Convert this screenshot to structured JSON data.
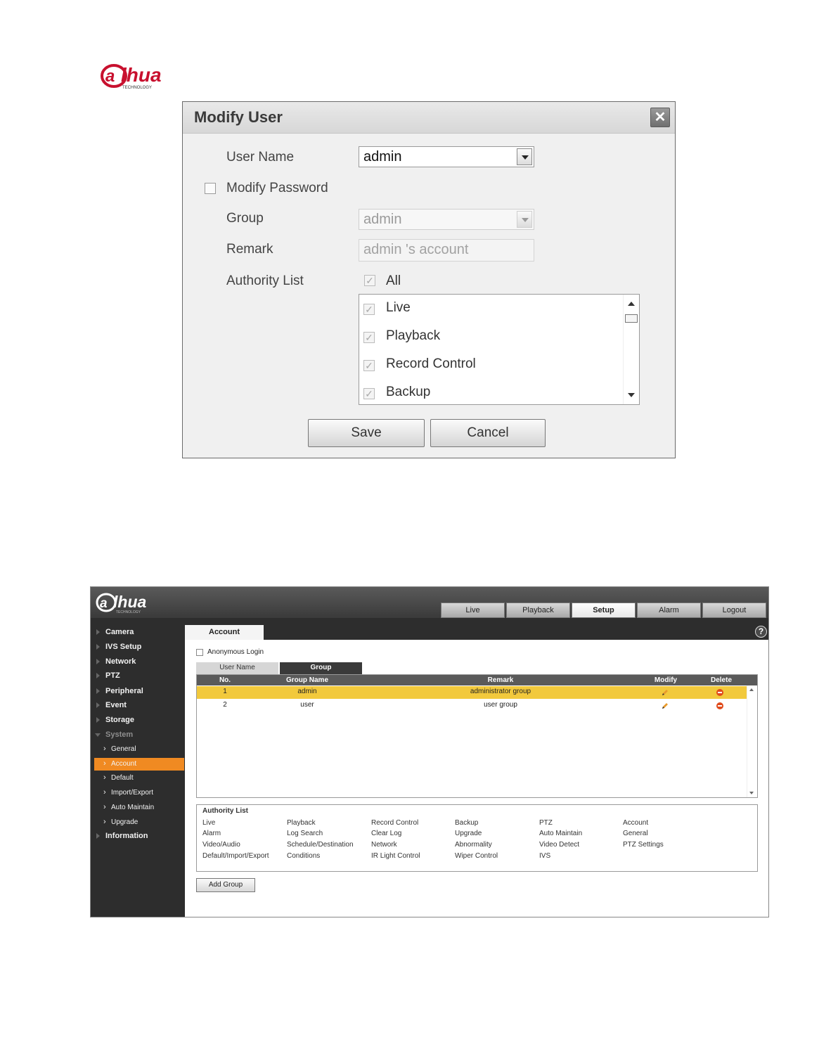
{
  "brand": {
    "name": "alhua",
    "tagline": "TECHNOLOGY",
    "color": "#c8102e"
  },
  "dialog": {
    "title": "Modify User",
    "close_icon": "close-icon",
    "user_name_label": "User Name",
    "user_name_value": "admin",
    "modify_password_label": "Modify Password",
    "modify_password_checked": false,
    "group_label": "Group",
    "group_value": "admin",
    "remark_label": "Remark",
    "remark_value": "admin 's account",
    "authority_label": "Authority List",
    "all_label": "All",
    "authority_items": [
      {
        "label": "Live",
        "checked": true
      },
      {
        "label": "Playback",
        "checked": true
      },
      {
        "label": "Record Control",
        "checked": true
      },
      {
        "label": "Backup",
        "checked": true
      }
    ],
    "save_label": "Save",
    "cancel_label": "Cancel"
  },
  "app": {
    "tabs": [
      "Live",
      "Playback",
      "Setup",
      "Alarm",
      "Logout"
    ],
    "active_tab": "Setup",
    "sidebar": {
      "items": [
        "Camera",
        "IVS Setup",
        "Network",
        "PTZ",
        "Peripheral",
        "Event",
        "Storage"
      ],
      "system": "System",
      "system_sub": [
        "General",
        "Account",
        "Default",
        "Import/Export",
        "Auto Maintain",
        "Upgrade"
      ],
      "active_sub": "Account",
      "information": "Information"
    },
    "page_tab": "Account",
    "help_icon": "help-icon",
    "anonymous_login_label": "Anonymous Login",
    "sub_tabs": [
      "User Name",
      "Group"
    ],
    "active_sub_tab": "Group",
    "table": {
      "columns": [
        "No.",
        "Group Name",
        "Remark",
        "Modify",
        "Delete"
      ],
      "rows": [
        {
          "no": "1",
          "group": "admin",
          "remark": "administrator group",
          "selected": true
        },
        {
          "no": "2",
          "group": "user",
          "remark": "user group",
          "selected": false
        }
      ]
    },
    "authority_list": {
      "title": "Authority List",
      "columns": [
        [
          "Live",
          "Alarm",
          "Video/Audio",
          "Default/Import/Export"
        ],
        [
          "Playback",
          "Log Search",
          "Schedule/Destination",
          "Conditions"
        ],
        [
          "Record Control",
          "Clear Log",
          "Network",
          "IR Light Control"
        ],
        [
          "Backup",
          "Upgrade",
          "Abnormality",
          "Wiper Control"
        ],
        [
          "PTZ",
          "Auto Maintain",
          "Video Detect",
          "IVS"
        ],
        [
          "Account",
          "General",
          "PTZ Settings"
        ]
      ]
    },
    "add_group_label": "Add Group",
    "colors": {
      "accent": "#f08a22",
      "selected_row": "#f2c93c",
      "dark": "#2d2d2d"
    }
  }
}
